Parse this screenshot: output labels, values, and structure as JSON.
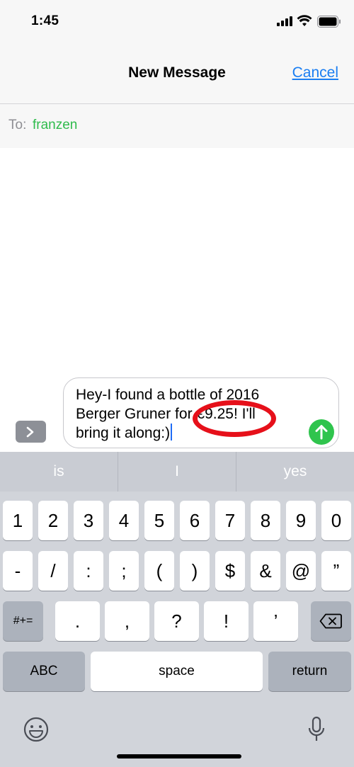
{
  "status_bar": {
    "time": "1:45"
  },
  "nav": {
    "title": "New Message",
    "cancel_label": "Cancel"
  },
  "to_row": {
    "label": "To:",
    "recipient": "franzen"
  },
  "composer": {
    "lines": [
      "Hey-I found a bottle of 2016",
      "Berger Gruner for €9.25! I'll",
      "bring it along:)"
    ],
    "annotation": "red ellipse around €9.25"
  },
  "keyboard": {
    "suggestions": [
      "is",
      "I",
      "yes"
    ],
    "row1": [
      "1",
      "2",
      "3",
      "4",
      "5",
      "6",
      "7",
      "8",
      "9",
      "0"
    ],
    "row2": [
      "-",
      "/",
      ":",
      ";",
      "(",
      ")",
      "$",
      "&",
      "@",
      "”"
    ],
    "row3": {
      "mode_key": "#+=",
      "keys": [
        ".",
        ",",
        "?",
        "!",
        "’"
      ]
    },
    "row4": {
      "abc": "ABC",
      "space": "space",
      "return": "return"
    }
  },
  "icons": [
    "signal-icon",
    "wifi-icon",
    "battery-icon",
    "chevron-right-icon",
    "send-arrow-icon",
    "backspace-icon",
    "emoji-icon",
    "microphone-icon"
  ],
  "colors": {
    "accent": "#1a7ef2",
    "recipient": "#2fbb4c",
    "send": "#2fc44d",
    "annotation": "#e6101a"
  }
}
